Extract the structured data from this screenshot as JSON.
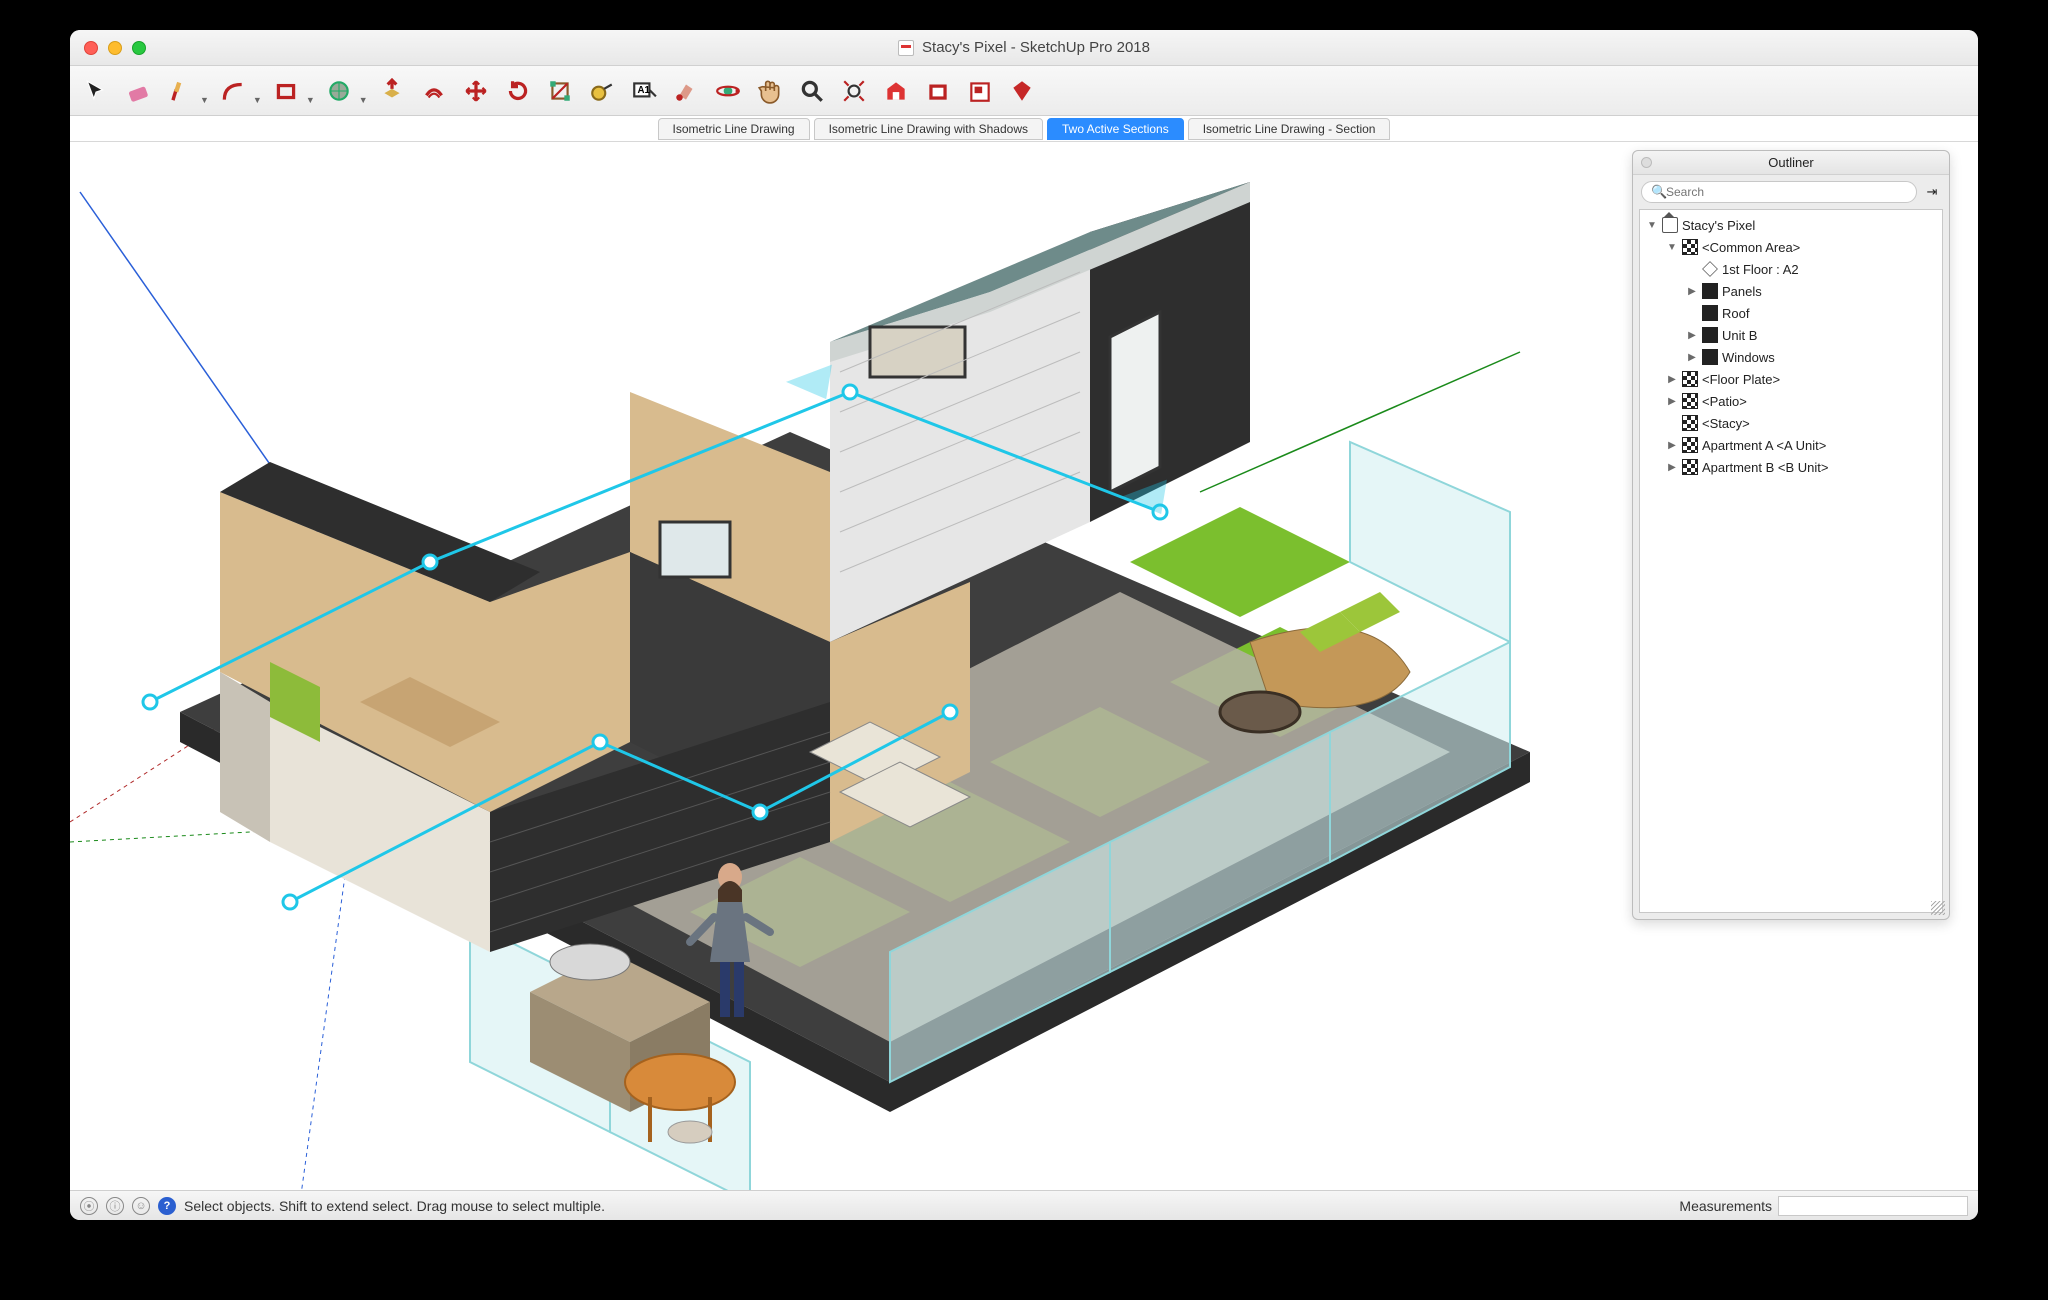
{
  "window": {
    "title": "Stacy's Pixel - SketchUp Pro 2018"
  },
  "toolbar": {
    "tools": [
      {
        "name": "select-tool",
        "svg": "cursor"
      },
      {
        "name": "eraser-tool",
        "svg": "eraser"
      },
      {
        "name": "line-tool",
        "svg": "pencil",
        "dd": true
      },
      {
        "name": "arc-tool",
        "svg": "arc",
        "dd": true
      },
      {
        "name": "rectangle-tool",
        "svg": "rect",
        "dd": true
      },
      {
        "name": "circle-tool",
        "svg": "circle",
        "dd": true
      },
      {
        "name": "pushpull-tool",
        "svg": "pushpull"
      },
      {
        "name": "offset-tool",
        "svg": "offset"
      },
      {
        "name": "move-tool",
        "svg": "move"
      },
      {
        "name": "rotate-tool",
        "svg": "rotate"
      },
      {
        "name": "scale-tool",
        "svg": "scale"
      },
      {
        "name": "tape-tool",
        "svg": "tape"
      },
      {
        "name": "text-tool",
        "svg": "text"
      },
      {
        "name": "paint-tool",
        "svg": "paint"
      },
      {
        "name": "orbit-tool",
        "svg": "orbit"
      },
      {
        "name": "pan-tool",
        "svg": "pan"
      },
      {
        "name": "zoom-tool",
        "svg": "zoom"
      },
      {
        "name": "zoom-extents-tool",
        "svg": "zoomext"
      },
      {
        "name": "warehouse-tool",
        "svg": "warehouse"
      },
      {
        "name": "extension-warehouse-tool",
        "svg": "extware"
      },
      {
        "name": "layout-tool",
        "svg": "layout"
      },
      {
        "name": "extensions-tool",
        "svg": "ruby"
      }
    ]
  },
  "scenes": [
    {
      "label": "Isometric Line Drawing",
      "active": false
    },
    {
      "label": "Isometric Line Drawing with Shadows",
      "active": false
    },
    {
      "label": "Two Active Sections",
      "active": true
    },
    {
      "label": "Isometric Line Drawing - Section",
      "active": false
    }
  ],
  "outliner": {
    "title": "Outliner",
    "search_placeholder": "Search",
    "tree": [
      {
        "depth": 0,
        "disc": "down",
        "icon": "house",
        "label": "Stacy's Pixel"
      },
      {
        "depth": 1,
        "disc": "down",
        "icon": "comp4",
        "label": "<Common Area>"
      },
      {
        "depth": 2,
        "disc": "blank",
        "icon": "sect",
        "label": "1st Floor : A2"
      },
      {
        "depth": 2,
        "disc": "right",
        "icon": "comp",
        "label": "Panels"
      },
      {
        "depth": 2,
        "disc": "blank",
        "icon": "comp",
        "label": "Roof"
      },
      {
        "depth": 2,
        "disc": "right",
        "icon": "comp",
        "label": "Unit B"
      },
      {
        "depth": 2,
        "disc": "right",
        "icon": "comp",
        "label": "Windows"
      },
      {
        "depth": 1,
        "disc": "right",
        "icon": "comp4",
        "label": "<Floor Plate>"
      },
      {
        "depth": 1,
        "disc": "right",
        "icon": "comp4",
        "label": "<Patio>"
      },
      {
        "depth": 1,
        "disc": "blank",
        "icon": "comp4",
        "label": "<Stacy>"
      },
      {
        "depth": 1,
        "disc": "right",
        "icon": "comp4",
        "label": "Apartment A <A Unit>"
      },
      {
        "depth": 1,
        "disc": "right",
        "icon": "comp4",
        "label": "Apartment B <B Unit>"
      }
    ]
  },
  "statusbar": {
    "hint": "Select objects. Shift to extend select. Drag mouse to select multiple.",
    "measurements_label": "Measurements",
    "measurements_value": ""
  }
}
